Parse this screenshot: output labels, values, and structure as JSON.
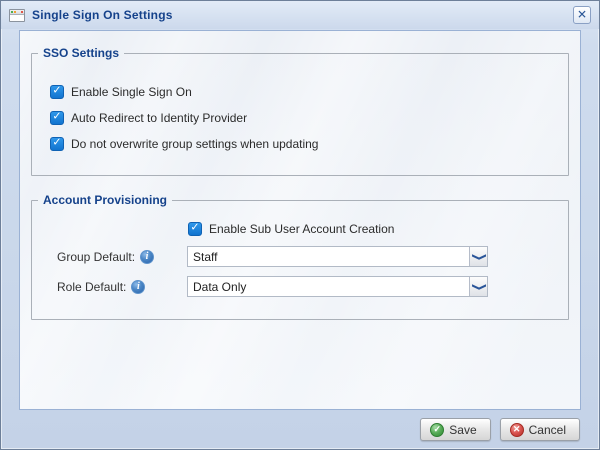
{
  "window": {
    "title": "Single Sign On Settings"
  },
  "sso": {
    "legend": "SSO Settings",
    "checkboxes": [
      {
        "label": "Enable Single Sign On",
        "checked": true
      },
      {
        "label": "Auto Redirect to Identity Provider",
        "checked": true
      },
      {
        "label": "Do not overwrite group settings when updating",
        "checked": true
      }
    ]
  },
  "account": {
    "legend": "Account Provisioning",
    "sub_user_checkbox": {
      "label": "Enable Sub User Account Creation",
      "checked": true
    },
    "fields": [
      {
        "label": "Group Default:",
        "value": "Staff"
      },
      {
        "label": "Role Default:",
        "value": "Data Only"
      }
    ]
  },
  "footer": {
    "save_label": "Save",
    "cancel_label": "Cancel"
  },
  "icons": {
    "check": "✓",
    "close": "✕",
    "info": "i",
    "chevron_down": "❯",
    "save": "✓",
    "cancel": "✕"
  },
  "colors": {
    "title_text": "#15428b",
    "legend_text": "#15428b",
    "frame_background": "#cbd8ea",
    "checkbox_fill": "#1d85dd",
    "info_icon_blue": "#2a62a8",
    "save_icon_green": "#57ab57",
    "cancel_icon_red": "#d9534f"
  }
}
